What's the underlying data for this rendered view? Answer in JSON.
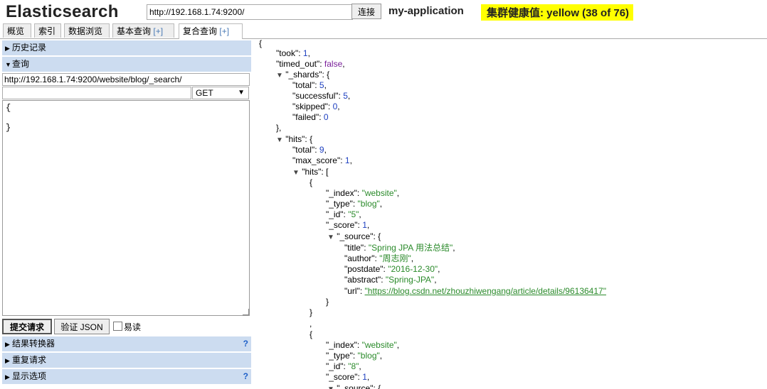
{
  "app": {
    "logo": "Elasticsearch",
    "connect_url": "http://192.168.1.74:9200/",
    "connect_button": "连接",
    "cluster_name": "my-application",
    "health": "集群健康值: yellow (38 of 76)"
  },
  "tabs": {
    "overview": "概览",
    "index": "索引",
    "browse": "数据浏览",
    "basic_query": "基本查询",
    "complex_query": "复合查询",
    "plus": "[+]"
  },
  "left": {
    "history": "历史记录",
    "query": "查询",
    "request_url": "http://192.168.1.74:9200/website/blog/_search/",
    "method": "GET",
    "body": "{\n\n}",
    "submit": "提交请求",
    "validate": "验证 JSON",
    "easy_read": "易读",
    "transformer": "结果转换器",
    "repeat": "重复请求",
    "display_options": "显示选项",
    "help": "?"
  },
  "result": {
    "took": "1",
    "timed_out": "false",
    "shards": {
      "total": "5",
      "successful": "5",
      "skipped": "0",
      "failed": "0"
    },
    "hits_total": "9",
    "max_score": "1",
    "doc1": {
      "index": "\"website\"",
      "type": "\"blog\"",
      "id": "\"5\"",
      "score": "1",
      "title": "\"Spring JPA 用法总结\"",
      "author": "\"周志刚\"",
      "postdate": "\"2016-12-30\"",
      "abstract": "\"Spring-JPA\"",
      "url": "\"https://blog.csdn.net/zhouzhiwengang/article/details/96136417\""
    },
    "doc2": {
      "index": "\"website\"",
      "type": "\"blog\"",
      "id": "\"8\"",
      "score": "1"
    }
  }
}
